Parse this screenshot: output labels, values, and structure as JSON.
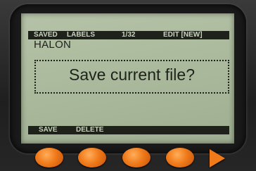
{
  "status_bar": {
    "saved": "SAVED",
    "labels": "LABELS",
    "page": "1/32",
    "edit": "EDIT [NEW]"
  },
  "filename": "HALON",
  "dialog": {
    "message": "Save current file?"
  },
  "softkeys": {
    "save": "SAVE",
    "delete": "DELETE"
  },
  "colors": {
    "lcd_background": "#aab99c",
    "lcd_ink": "#1e221b",
    "button_accent": "#f07a1a"
  },
  "icons": [
    "softkey-button",
    "softkey-button",
    "softkey-button",
    "softkey-button",
    "arrow-right-icon"
  ]
}
